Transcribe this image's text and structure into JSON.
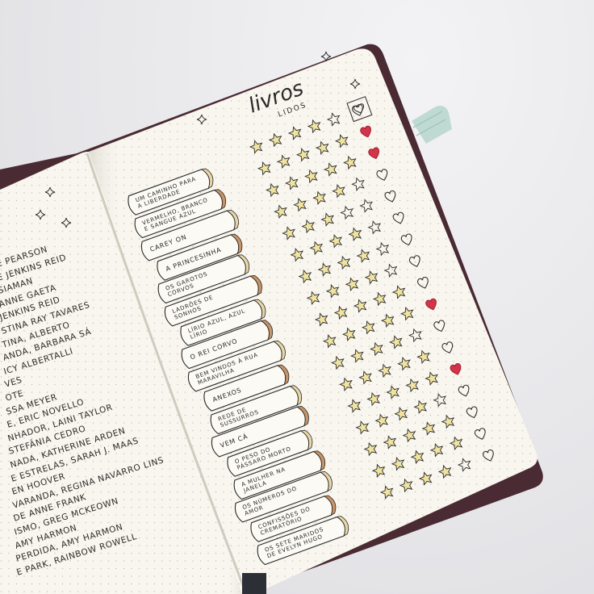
{
  "page": {
    "heading_script": "livros",
    "heading_sub": "LIDOS"
  },
  "books": [
    {
      "title": "UM CAMINHO PARA A LIBERDADE",
      "rating": 4,
      "fav": false
    },
    {
      "title": "VERMELHO, BRANCO E SANGUE AZUL",
      "rating": 5,
      "fav": true
    },
    {
      "title": "CAREY ON",
      "rating": 5,
      "fav": true
    },
    {
      "title": "A PRINCESINHA",
      "rating": 4,
      "fav": false
    },
    {
      "title": "OS GAROTOS CORVOS",
      "rating": 3,
      "fav": false
    },
    {
      "title": "LADRÕES DE SONHOS",
      "rating": 4,
      "fav": false
    },
    {
      "title": "LÍRIO AZUL, AZUL LÍRIO",
      "rating": 4,
      "fav": false
    },
    {
      "title": "O REI CORVO",
      "rating": 4,
      "fav": false
    },
    {
      "title": "BEM VINDOS À RUA MARAVILHA",
      "rating": 5,
      "fav": false
    },
    {
      "title": "ANEXOS",
      "rating": 5,
      "fav": true
    },
    {
      "title": "REDE DE SUSSURROS",
      "rating": 4,
      "fav": false
    },
    {
      "title": "VEM CÁ",
      "rating": 5,
      "fav": false
    },
    {
      "title": "O PESO DO PÁSSARO MORTO",
      "rating": 5,
      "fav": true
    },
    {
      "title": "A MULHER NA JANELA",
      "rating": 4,
      "fav": false
    },
    {
      "title": "OS NÚMEROS DO AMOR",
      "rating": 5,
      "fav": false
    },
    {
      "title": "CONFISSÕES DO CREMATÓRIO",
      "rating": 5,
      "fav": false
    },
    {
      "title": "OS SETE MARIDOS DE EVELYN HUGO",
      "rating": 4,
      "fav": false
    }
  ],
  "left_page_lines": [
    "E PEARSON",
    "E JENKINS REID",
    "SIAMAN",
    "ANNE GAETA",
    "JENKINS REID",
    "STINA RAY TAVARES",
    "TINA, ALBERTO",
    "ANDA, BARBARA SÁ",
    "ICY ALBERTALLI",
    "VES",
    "OTE",
    "SSA MEYER",
    "E, ERIC NOVELLO",
    "NHADOR, LAINI TAYLOR",
    "STEFÂNIA CEDRO",
    "NADA, KATHERINE ARDEN",
    "E ESTRELAS, SARAH J. MAAS",
    "EN HOOVER",
    "VARANDA, REGINA NAVARRO LINS",
    "DE ANNE FRANK",
    "ISMO, GREG MCKEOWN",
    "AMY HARMON",
    "PERDIDA, AMY HARMON",
    "E PARK, RAINBOW ROWELL"
  ],
  "colors": {
    "paper": "#f8f6ee",
    "star_fill": "#f0e3a0",
    "ink": "#2a2a2a",
    "heart": "#d3344a",
    "ribbon": "#bfdad2",
    "cover": "#4a2a33",
    "book_edge": "#c99466",
    "book_pages": "#e8d6a8"
  }
}
